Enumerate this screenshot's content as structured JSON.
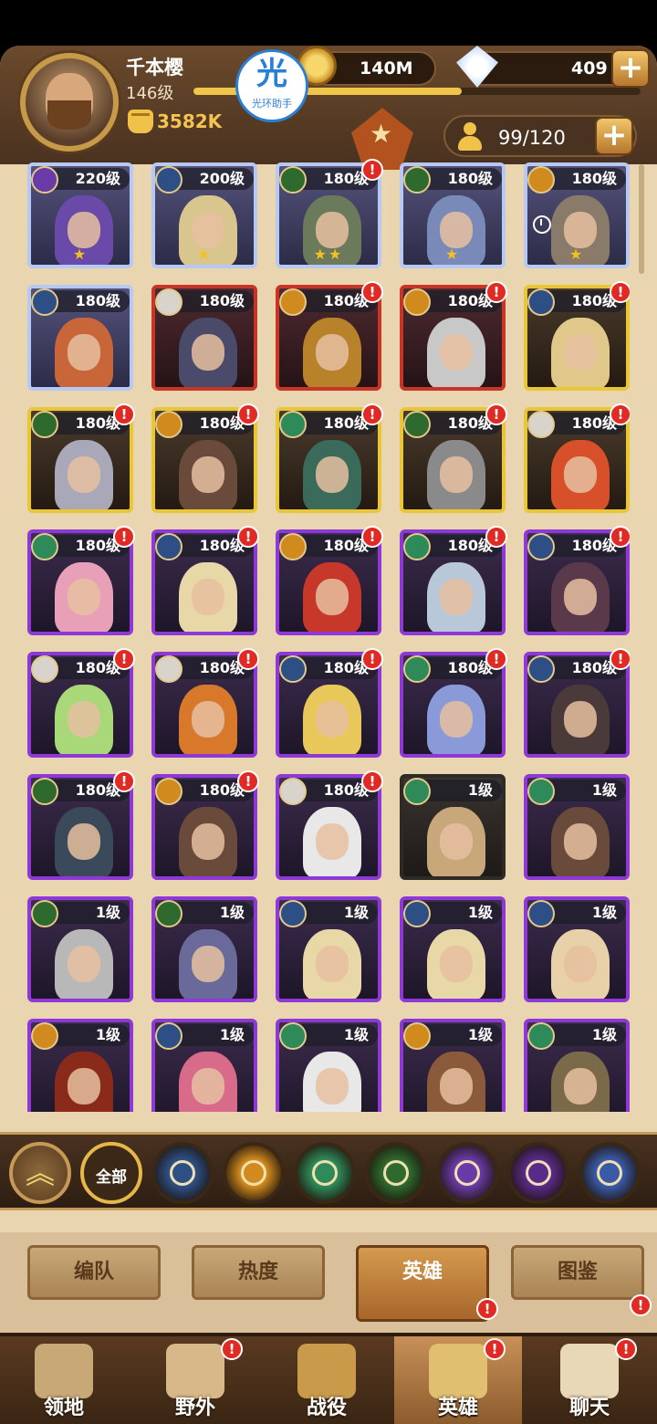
{
  "player": {
    "name": "千本樱",
    "level": "146级",
    "power": "3582K",
    "xp_fraction": 0.6
  },
  "resources": {
    "gold": "140M",
    "gems": "409",
    "plus_symbol": "+"
  },
  "watermark": {
    "glyph": "光",
    "text": "光环助手"
  },
  "roster": {
    "capacity": "99/120"
  },
  "heroes": [
    {
      "level": "220级",
      "frame": "f-blue",
      "faction": "celestial",
      "stars": "★",
      "alert": false,
      "tone": "#6a4aa8"
    },
    {
      "level": "200级",
      "frame": "f-blue",
      "faction": "lightbearer",
      "stars": "★",
      "alert": false,
      "tone": "#d9c58e"
    },
    {
      "level": "180级",
      "frame": "f-blue",
      "faction": "maulers",
      "stars": "★★",
      "alert": true,
      "tone": "#6a7a5a"
    },
    {
      "level": "180级",
      "frame": "f-blue",
      "faction": "maulers",
      "stars": "★",
      "alert": false,
      "tone": "#7a8ab8"
    },
    {
      "level": "180级",
      "frame": "f-blue",
      "faction": "graveborn",
      "stars": "★",
      "alert": false,
      "clock": true,
      "tone": "#8a7a6a"
    },
    {
      "level": "180级",
      "frame": "f-blue",
      "faction": "lightbearer",
      "stars": "",
      "alert": false,
      "tone": "#c8663a"
    },
    {
      "level": "180级",
      "frame": "f-red",
      "faction": "celestial-white",
      "stars": "",
      "alert": false,
      "tone": "#4a4a6a"
    },
    {
      "level": "180级",
      "frame": "f-red",
      "faction": "graveborn",
      "stars": "",
      "alert": true,
      "tone": "#b8822a"
    },
    {
      "level": "180级",
      "frame": "f-red",
      "faction": "graveborn",
      "stars": "",
      "alert": true,
      "tone": "#c8c8c8"
    },
    {
      "level": "180级",
      "frame": "f-gold",
      "faction": "lightbearer",
      "stars": "",
      "alert": true,
      "tone": "#e0c88a"
    },
    {
      "level": "180级",
      "frame": "f-gold",
      "faction": "maulers",
      "stars": "",
      "alert": true,
      "tone": "#a8a8b8"
    },
    {
      "level": "180级",
      "frame": "f-gold",
      "faction": "graveborn",
      "stars": "",
      "alert": true,
      "tone": "#6a4a3a"
    },
    {
      "level": "180级",
      "frame": "f-gold",
      "faction": "wilder",
      "stars": "",
      "alert": true,
      "tone": "#3a6a5a"
    },
    {
      "level": "180级",
      "frame": "f-gold",
      "faction": "maulers",
      "stars": "",
      "alert": true,
      "tone": "#8a8a8a"
    },
    {
      "level": "180级",
      "frame": "f-gold",
      "faction": "celestial-white",
      "stars": "",
      "alert": true,
      "tone": "#d8502a"
    },
    {
      "level": "180级",
      "frame": "f-purple",
      "faction": "wilder",
      "stars": "",
      "alert": true,
      "tone": "#e8a0b8"
    },
    {
      "level": "180级",
      "frame": "f-purple",
      "faction": "lightbearer",
      "stars": "",
      "alert": true,
      "tone": "#e8d8a8"
    },
    {
      "level": "180级",
      "frame": "f-purple",
      "faction": "graveborn",
      "stars": "",
      "alert": true,
      "tone": "#c8382a"
    },
    {
      "level": "180级",
      "frame": "f-purple",
      "faction": "wilder",
      "stars": "",
      "alert": true,
      "tone": "#b8c8d8"
    },
    {
      "level": "180级",
      "frame": "f-purple",
      "faction": "lightbearer",
      "stars": "",
      "alert": true,
      "tone": "#5a3a4a"
    },
    {
      "level": "180级",
      "frame": "f-purple",
      "faction": "celestial-white",
      "stars": "",
      "alert": true,
      "tone": "#a8d878"
    },
    {
      "level": "180级",
      "frame": "f-purple",
      "faction": "celestial-white",
      "stars": "",
      "alert": true,
      "tone": "#d8782a"
    },
    {
      "level": "180级",
      "frame": "f-purple",
      "faction": "lightbearer",
      "stars": "",
      "alert": true,
      "tone": "#e8c85a"
    },
    {
      "level": "180级",
      "frame": "f-purple",
      "faction": "wilder",
      "stars": "",
      "alert": true,
      "tone": "#8a9ad8"
    },
    {
      "level": "180级",
      "frame": "f-purple",
      "faction": "lightbearer",
      "stars": "",
      "alert": true,
      "tone": "#4a3a3a"
    },
    {
      "level": "180级",
      "frame": "f-purple",
      "faction": "maulers",
      "stars": "",
      "alert": true,
      "tone": "#3a4a5a"
    },
    {
      "level": "180级",
      "frame": "f-purple",
      "faction": "graveborn",
      "stars": "",
      "alert": true,
      "tone": "#6a4a3a"
    },
    {
      "level": "180级",
      "frame": "f-purple",
      "faction": "celestial-white",
      "stars": "",
      "alert": true,
      "tone": "#e8e8e8"
    },
    {
      "level": "1级",
      "frame": "f-plain",
      "faction": "wilder",
      "stars": "",
      "alert": false,
      "tone": "#c8a87a"
    },
    {
      "level": "1级",
      "frame": "f-purple",
      "faction": "wilder",
      "stars": "",
      "alert": false,
      "tone": "#6a4a3a"
    },
    {
      "level": "1级",
      "frame": "f-purple",
      "faction": "maulers",
      "stars": "",
      "alert": false,
      "tone": "#b8b8b8"
    },
    {
      "level": "1级",
      "frame": "f-purple",
      "faction": "maulers",
      "stars": "",
      "alert": false,
      "tone": "#6a6a9a"
    },
    {
      "level": "1级",
      "frame": "f-purple",
      "faction": "lightbearer",
      "stars": "",
      "alert": false,
      "tone": "#e8d8a8"
    },
    {
      "level": "1级",
      "frame": "f-purple",
      "faction": "lightbearer",
      "stars": "",
      "alert": false,
      "tone": "#e8d8a8"
    },
    {
      "level": "1级",
      "frame": "f-purple",
      "faction": "lightbearer",
      "stars": "",
      "alert": false,
      "tone": "#e8d0a8"
    },
    {
      "level": "1级",
      "frame": "f-purple",
      "faction": "graveborn",
      "stars": "",
      "alert": false,
      "tone": "#8a2a1a"
    },
    {
      "level": "1级",
      "frame": "f-purple",
      "faction": "lightbearer",
      "stars": "",
      "alert": false,
      "tone": "#d86a8a"
    },
    {
      "level": "1级",
      "frame": "f-purple",
      "faction": "wilder",
      "stars": "",
      "alert": false,
      "tone": "#e8e8e8"
    },
    {
      "level": "1级",
      "frame": "f-purple",
      "faction": "graveborn",
      "stars": "",
      "alert": false,
      "tone": "#8a5a3a"
    },
    {
      "level": "1级",
      "frame": "f-purple",
      "faction": "wilder",
      "stars": "",
      "alert": false,
      "tone": "#7a6a4a"
    }
  ],
  "faction_filters": {
    "all_label": "全部",
    "items": [
      "lightbearer",
      "graveborn",
      "wilder",
      "maulers",
      "celestial",
      "hypogean",
      "dimensional"
    ]
  },
  "faction_colors": {
    "lightbearer": "#2d4f86",
    "graveborn": "#d18a1e",
    "wilder": "#2f8a5a",
    "maulers": "#2e6a2e",
    "celestial": "#6a3aa8",
    "celestial-white": "#d8d4cc",
    "hypogean": "#5a2a8a",
    "dimensional": "#3a5aa8"
  },
  "tabs": [
    "编队",
    "热度",
    "英雄",
    "图鉴"
  ],
  "nav": [
    {
      "label": "领地",
      "icon": "castle-icon",
      "alert": false
    },
    {
      "label": "野外",
      "icon": "scroll-map-icon",
      "alert": true
    },
    {
      "label": "战役",
      "icon": "sword-shield-icon",
      "alert": false
    },
    {
      "label": "英雄",
      "icon": "helmet-icon",
      "alert": true
    },
    {
      "label": "聊天",
      "icon": "chat-bubble-icon",
      "alert": true
    }
  ],
  "alert_symbol": "!"
}
